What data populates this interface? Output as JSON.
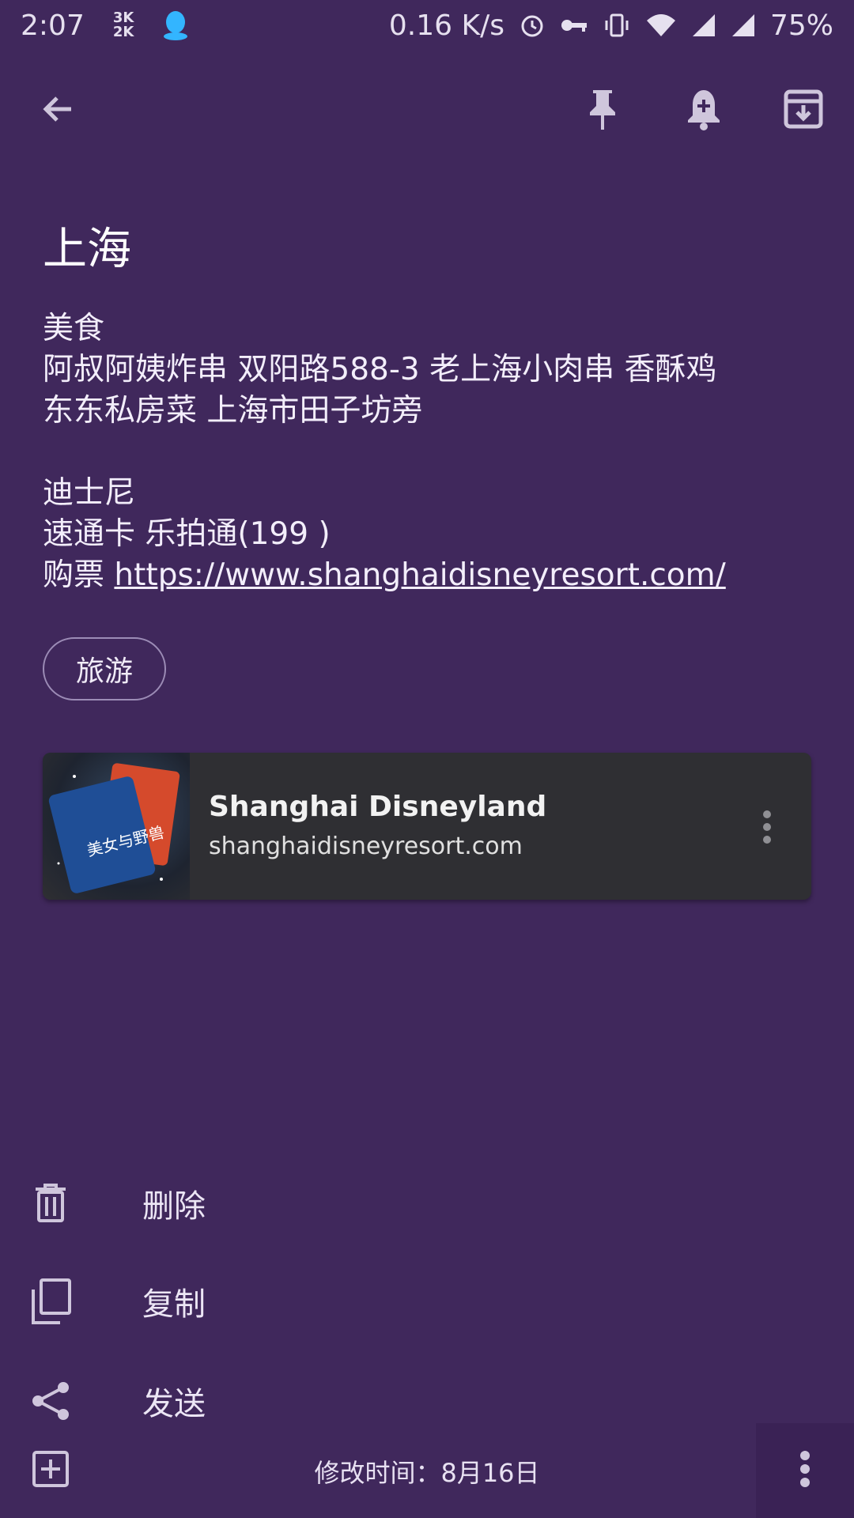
{
  "status_bar": {
    "time": "2:07",
    "speed_small_top": "3K",
    "speed_small_bottom": "2K",
    "net_speed": "0.16 K/s",
    "battery": "75%",
    "icons": [
      "qq-icon",
      "alarm-icon",
      "vpn-key-icon",
      "vibrate-icon",
      "wifi-icon",
      "signal-icon",
      "signal-icon-2"
    ]
  },
  "toolbar": {
    "icons": [
      "back-arrow-icon",
      "pin-icon",
      "reminder-bell-icon",
      "archive-icon"
    ]
  },
  "note": {
    "title": "上海",
    "lines": [
      "美食",
      "阿叔阿姨炸串 双阳路588-3  老上海小肉串 香酥鸡",
      "东东私房菜 上海市田子坊旁",
      "",
      "迪士尼",
      "速通卡 乐拍通(199 )"
    ],
    "ticket_prefix": "购票 ",
    "ticket_link": "https://www.shanghaidisneyresort.com/",
    "label": "旅游"
  },
  "link_preview": {
    "title": "Shanghai Disneyland",
    "domain": "shanghaidisneyresort.com",
    "thumbnail_text": "美女与野兽"
  },
  "menu": {
    "delete": "删除",
    "copy": "复制",
    "send": "发送"
  },
  "bottom": {
    "modified": "修改时间：8月16日"
  },
  "colors": {
    "background": "#40285c",
    "card": "#2f2f33",
    "chip_border": "#9c8cb6"
  }
}
